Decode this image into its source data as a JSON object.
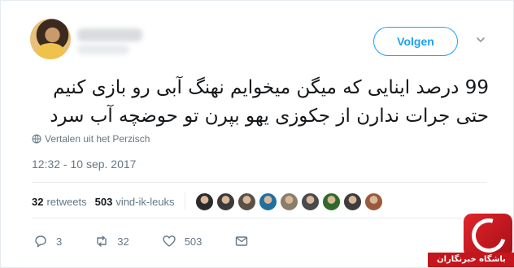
{
  "header": {
    "follow_label": "Volgen"
  },
  "tweet": {
    "lines": [
      "99 درصد اینایی که میگن میخوایم نهنگ آبی رو بازی کنیم",
      "حتی جرات ندارن از جکوزی یهو بپرن تو حوضچه آب سرد"
    ],
    "translate_label": "Vertalen uit het Perzisch",
    "timestamp": "12:32 - 10 sep. 2017"
  },
  "stats": {
    "retweets_count": "32",
    "retweets_label": "retweets",
    "likes_count": "503",
    "likes_label": "vind-ik-leuks",
    "liker_faces": [
      {
        "color": "#2b2b2b"
      },
      {
        "color": "#3a3a3a"
      },
      {
        "color": "#5a5048"
      },
      {
        "color": "#1f6fa0"
      },
      {
        "color": "#8a7d6a"
      },
      {
        "color": "#4a4a4a"
      },
      {
        "color": "#2f6a2a"
      },
      {
        "color": "#3d3d3d"
      },
      {
        "color": "#9c5a3c"
      }
    ]
  },
  "actions": {
    "reply_count": "3",
    "retweet_count": "32",
    "like_count": "503"
  },
  "watermark": {
    "label": "باشگاه خبرنگاران"
  },
  "colors": {
    "accent": "#1da1f2",
    "muted": "#657786",
    "text": "#14171a",
    "watermark_red": "#c4161c"
  }
}
